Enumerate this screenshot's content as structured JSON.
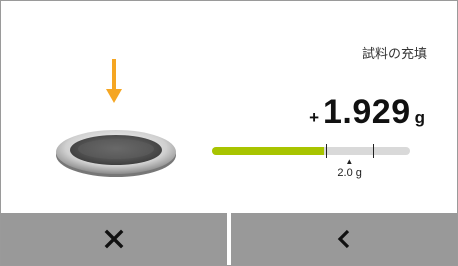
{
  "header": {
    "title": "試料の充填"
  },
  "reading": {
    "sign": "+",
    "value": "1.929",
    "unit": "g"
  },
  "progress": {
    "fraction": 0.567,
    "tolerance_low_fraction": 0.577,
    "tolerance_high_fraction": 0.812,
    "target_fraction": 0.694
  },
  "target": {
    "label": "2.0 g"
  },
  "footer": {
    "cancel_icon": "close-icon",
    "back_icon": "chevron-left-icon"
  },
  "colors": {
    "accent": "#f5a623",
    "progress": "#a8c400",
    "track": "#d9d9d9",
    "button": "#999999"
  }
}
